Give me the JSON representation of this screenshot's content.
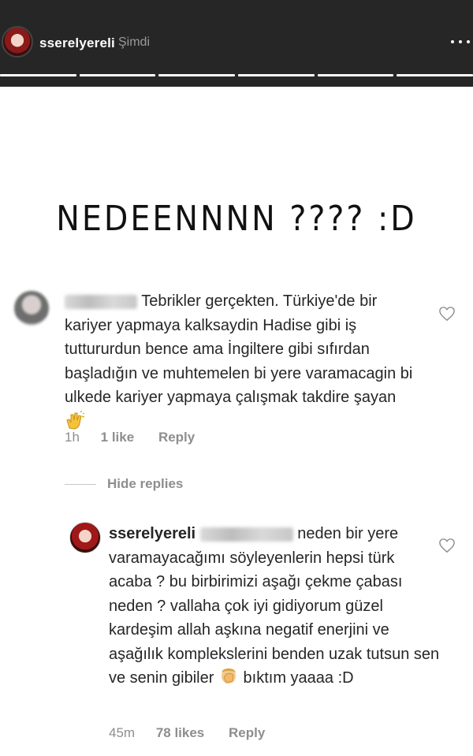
{
  "story": {
    "username": "sserelyereli",
    "time": "Şimdi",
    "headline": "NEDEENNNN ???? :D"
  },
  "comments": [
    {
      "text": "Tebrikler gerçekten. Türkiye'de bir kariyer yapmaya kalksaydin Hadise gibi iş tuttururdun bence ama İngiltere gibi sıfırdan başladığın ve muhtemelen bi yere varamacagin bi ulkede kariyer yapmaya çalışmak takdire şayan",
      "emoji": "clapping-hands",
      "time": "1h",
      "likes": "1 like",
      "reply": "Reply"
    },
    {
      "username": "sserelyereli",
      "text": "neden bir yere varamayacağımı söyleyenlerin hepsi türk acaba ? bu birbirimizi aşağı çekme çabası neden ? vallaha çok iyi gidiyorum güzel kardeşim allah aşkına negatif enerjini ve aşağılık komplekslerini benden uzak tutsun sen ve senin gibiler",
      "emoji": "facepalm",
      "text_end": "bıktım yaaaa :D",
      "time": "45m",
      "likes": "78 likes",
      "reply": "Reply"
    }
  ],
  "hide_replies": "Hide replies",
  "colors": {
    "header_bg": "#262626",
    "text": "#262626",
    "meta": "#8e8e8e"
  }
}
